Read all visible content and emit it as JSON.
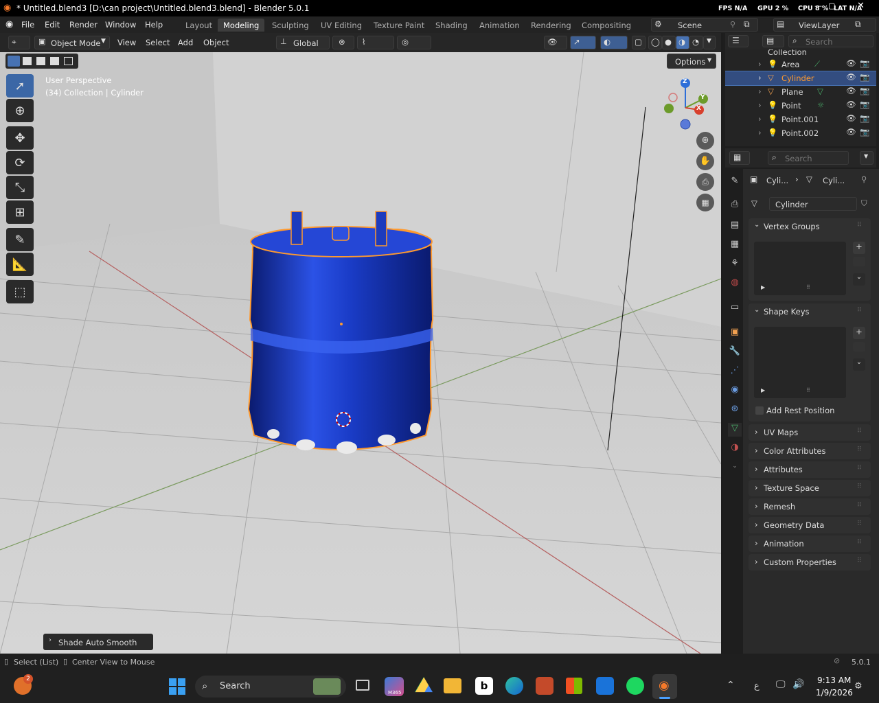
{
  "window": {
    "title": "* Untitled.blend3 [D:\\can project\\Untitled.blend3.blend] - Blender 5.0.1",
    "stats": {
      "fps": "FPS N/A",
      "gpu": "GPU  2 %",
      "cpu": "CPU  8 %",
      "lat": "LAT  N/A"
    }
  },
  "menu": [
    "File",
    "Edit",
    "Render",
    "Window",
    "Help"
  ],
  "workspaces": [
    "Layout",
    "Modeling",
    "Sculpting",
    "UV Editing",
    "Texture Paint",
    "Shading",
    "Animation",
    "Rendering",
    "Compositing"
  ],
  "scene": "Scene",
  "view_layer": "ViewLayer",
  "viewport_header": {
    "mode": "Object Mode",
    "menus": [
      "View",
      "Select",
      "Add",
      "Object"
    ],
    "transform": "Global",
    "options": "Options"
  },
  "viewport_overlay": {
    "perspective": "User Perspective",
    "collection": "(34) Collection | Cylinder",
    "gizmo": {
      "z": "Z",
      "y": "Y",
      "x": "X"
    }
  },
  "last_op": "Shade Auto Smooth",
  "outliner": {
    "search_placeholder": "Search",
    "collection": "Collection",
    "items": [
      {
        "label": "Area",
        "selected": false
      },
      {
        "label": "Cylinder",
        "selected": true
      },
      {
        "label": "Plane",
        "selected": false
      },
      {
        "label": "Point",
        "selected": false
      },
      {
        "label": "Point.001",
        "selected": false
      },
      {
        "label": "Point.002",
        "selected": false
      }
    ]
  },
  "properties": {
    "search_placeholder": "Search",
    "breadcrumb": [
      "Cyli...",
      "Cyli..."
    ],
    "mesh_name": "Cylinder",
    "panels": {
      "vertex_groups": "Vertex Groups",
      "shape_keys": "Shape Keys",
      "add_rest": "Add Rest Position",
      "collapsed": [
        "UV Maps",
        "Color Attributes",
        "Attributes",
        "Texture Space",
        "Remesh",
        "Geometry Data",
        "Animation",
        "Custom Properties"
      ]
    }
  },
  "statusbar": {
    "left1": "Select (List)",
    "left2": "Center View to Mouse",
    "version": "5.0.1"
  },
  "taskbar": {
    "search": "Search",
    "time": "9:13 AM",
    "date": "1/9/2026",
    "notif": "2",
    "lang": "ع",
    "m365": "M365"
  },
  "colors": {
    "accent": "#4772b3",
    "selected_outline": "#ff9a2e",
    "cylinder": "#1a3cc7"
  }
}
